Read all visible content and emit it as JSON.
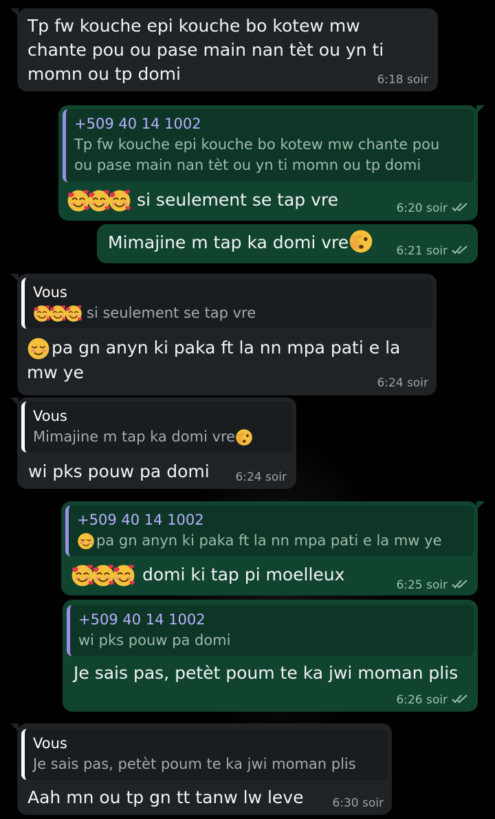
{
  "messages": [
    {
      "id": "m1",
      "direction": "incoming",
      "text_lines": [
        "Tp fw kouche epi kouche bo kotew mw",
        "chante pou ou pase main nan tèt ou yn ti",
        "momn ou tp domi"
      ],
      "time": "6:18 soir"
    },
    {
      "id": "m2",
      "direction": "outgoing",
      "reply_to": {
        "author": "+509 40 14 1002",
        "text_lines": [
          "Tp fw kouche epi kouche bo kotew mw chante pou",
          "ou pase main nan tèt ou yn ti momn ou tp domi"
        ]
      },
      "text": "si seulement se tap vre",
      "emoji": [
        "smiling-face-with-hearts",
        "smiling-face-with-hearts",
        "smiling-face-with-hearts"
      ],
      "time": "6:20 soir"
    },
    {
      "id": "m3",
      "direction": "outgoing",
      "text": "Mimajine m tap ka domi vre",
      "emoji": [
        "face-with-peeking-eye"
      ],
      "time": "6:21 soir"
    },
    {
      "id": "m4",
      "direction": "incoming",
      "reply_to": {
        "author": "Vous",
        "text": "si seulement se tap vre"
      },
      "text_lines": [
        "pa gn anyn ki paka ft la nn mpa pati e la",
        "mw ye"
      ],
      "emoji": [
        "smiling-face"
      ],
      "time": "6:24 soir"
    },
    {
      "id": "m5",
      "direction": "incoming",
      "reply_to": {
        "author": "Vous",
        "text": "Mimajine m tap ka domi vre"
      },
      "text": "wi pks pouw pa domi",
      "time": "6:24 soir"
    },
    {
      "id": "m6",
      "direction": "outgoing",
      "reply_to": {
        "author": "+509 40 14 1002",
        "text": "pa gn anyn ki paka ft la nn mpa pati e la mw ye"
      },
      "text": "domi ki tap pi moelleux",
      "time": "6:25 soir"
    },
    {
      "id": "m7",
      "direction": "outgoing",
      "reply_to": {
        "author": "+509 40 14 1002",
        "text": "wi pks pouw pa domi"
      },
      "text": "Je sais pas, petèt poum te ka jwi moman plis",
      "time": "6:26 soir"
    },
    {
      "id": "m8",
      "direction": "incoming",
      "reply_to": {
        "author": "Vous",
        "text": "Je sais pas, petèt poum te ka jwi moman plis"
      },
      "text": "Aah mn ou tp gn tt tanw lw leve",
      "time": "6:30 soir"
    }
  ],
  "colors": {
    "background": "#000000",
    "incoming_bubble": "#1f2326",
    "outgoing_bubble": "#11442f",
    "quote_bar": "#9b8ee8",
    "read_ticks": "#9cc2ae"
  },
  "icons": {
    "read_receipt": "double-check-icon"
  }
}
